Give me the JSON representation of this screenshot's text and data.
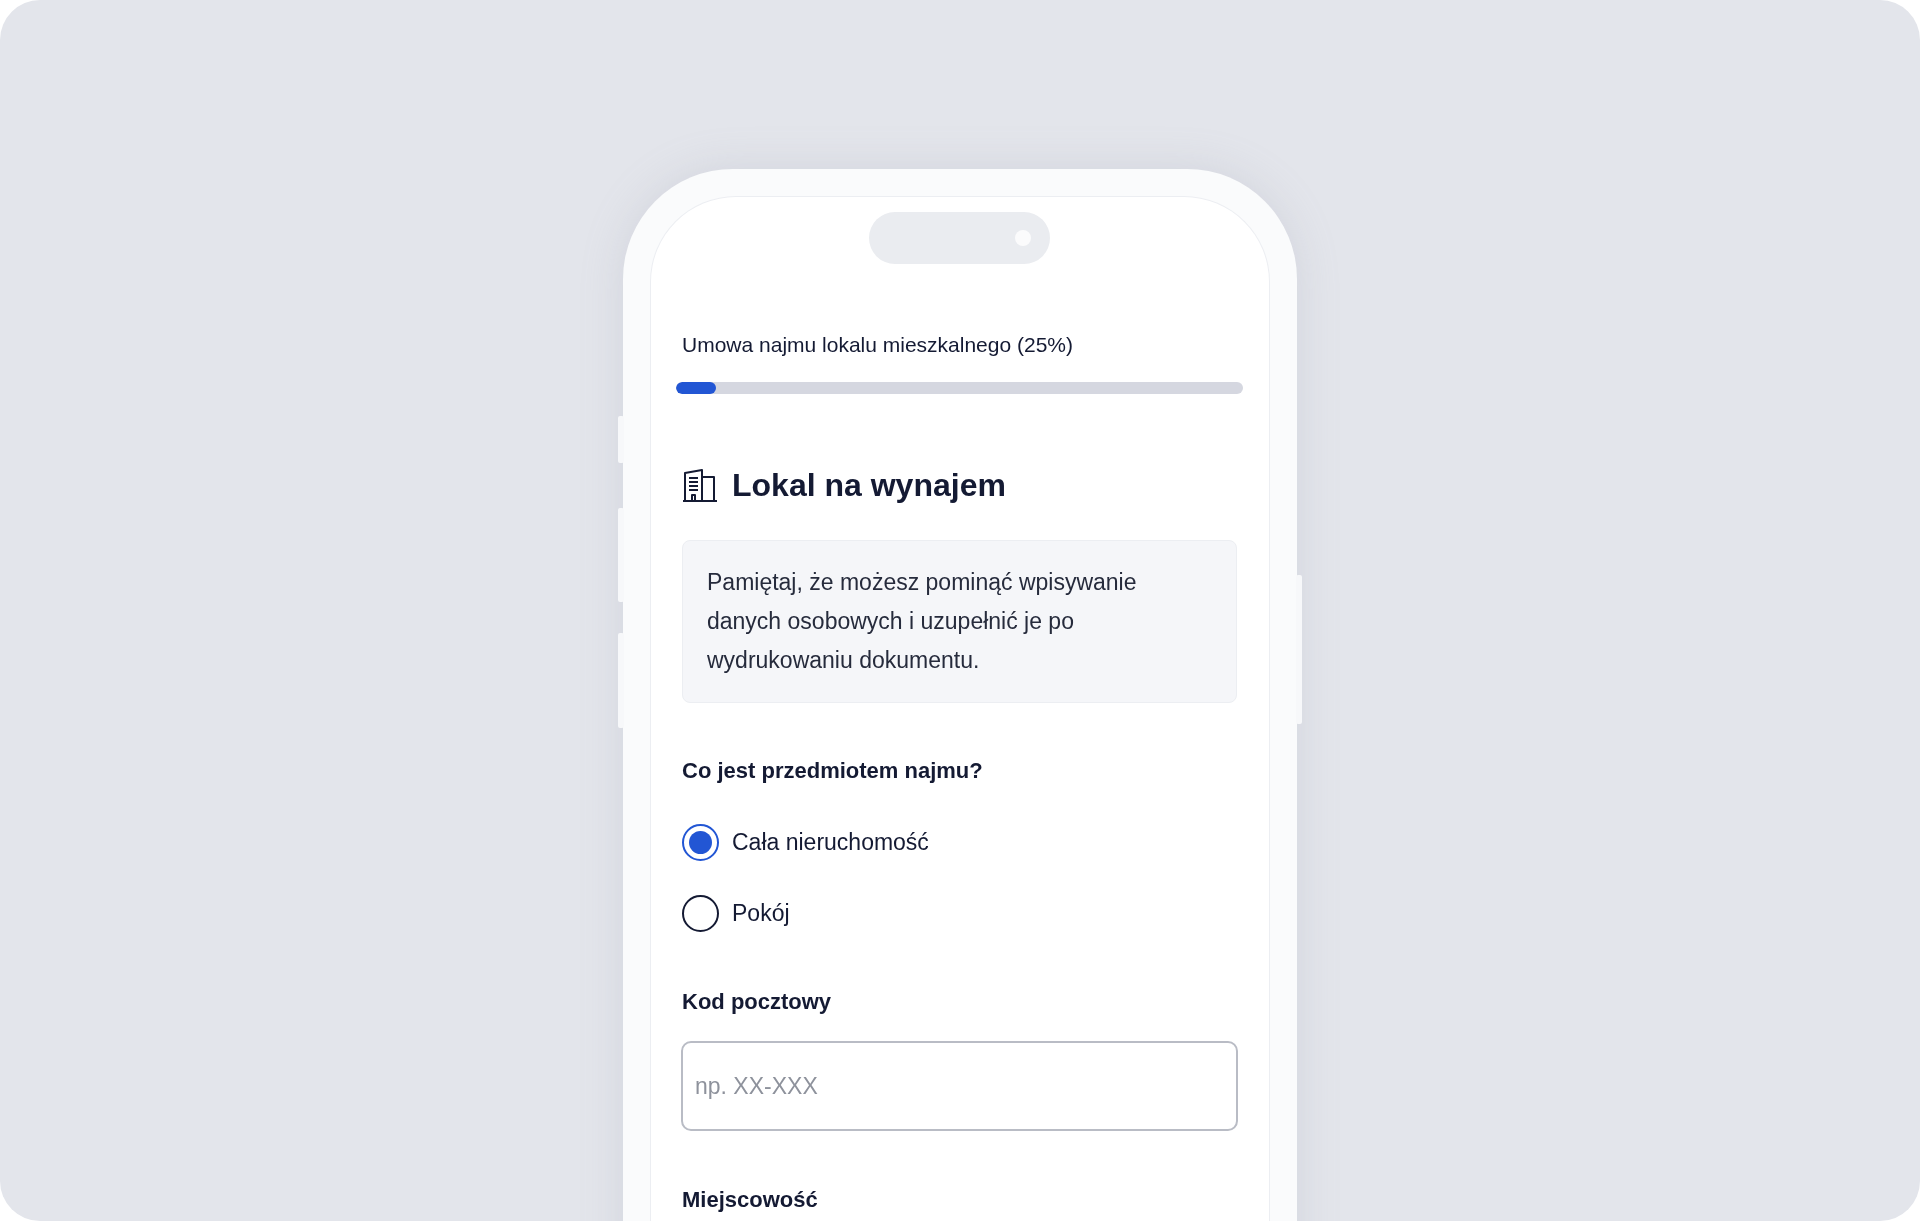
{
  "progress": {
    "label": "Umowa najmu lokalu mieszkalnego (25%)",
    "level": 0.07
  },
  "section": {
    "title": "Lokal na wynajem",
    "info": "Pamiętaj, że możesz pominąć wpisywanie danych osobowych i uzupełnić je po wydrukowaniu dokumentu."
  },
  "question": {
    "label": "Co jest przedmiotem najmu?",
    "options": [
      {
        "label": "Cała nieruchomość",
        "selected": true
      },
      {
        "label": "Pokój",
        "selected": false
      }
    ]
  },
  "fields": [
    {
      "label": "Kod pocztowy",
      "placeholder": "np. XX-XXX"
    },
    {
      "label": "Miejscowość"
    }
  ]
}
